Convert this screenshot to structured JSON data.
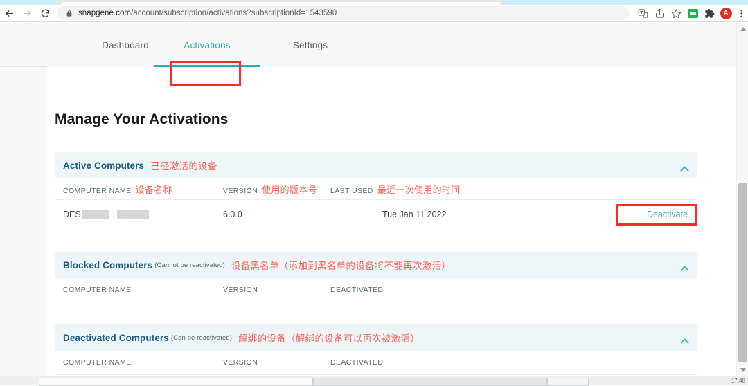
{
  "browser": {
    "url_prefix": "snapgene.com",
    "url_suffix": "/account/subscription/activations?subscriptionId=1543590",
    "back_icon": "back-arrow-icon",
    "forward_icon": "forward-arrow-icon",
    "reload_icon": "reload-icon",
    "lock_icon": "lock-icon",
    "translate_icon": "translate-icon",
    "share_icon": "share-icon",
    "bookmark_icon": "star-icon",
    "extension_green_icon": "green-extension-icon",
    "extensions_icon": "puzzle-piece-icon",
    "avatar_label": "A",
    "menu_icon": "three-dot-menu-icon"
  },
  "nav": {
    "tabs": [
      {
        "label": "Dashboard",
        "active": false
      },
      {
        "label": "Activations",
        "active": true
      },
      {
        "label": "Settings",
        "active": false
      }
    ]
  },
  "page": {
    "title": "Manage Your Activations"
  },
  "sections": [
    {
      "title_en": "Active Computers",
      "title_sub": "",
      "title_cn": "已经激活的设备",
      "collapse_icon": "chevron-up-icon",
      "columns": [
        {
          "label": "COMPUTER NAME",
          "cn": "设备名称"
        },
        {
          "label": "VERSION",
          "cn": "使用的版本号"
        },
        {
          "label": "LAST USED",
          "cn": "最近一次使用的时间"
        }
      ],
      "rows": [
        {
          "computer_name": "DES",
          "version": "6.0.0",
          "last_used": "Tue Jan 11 2022",
          "action": "Deactivate"
        }
      ]
    },
    {
      "title_en": "Blocked Computers",
      "title_sub": "(Cannot be reactivated)",
      "title_cn": "设备黑名单（添加到黑名单的设备将不能再次激活）",
      "collapse_icon": "chevron-up-icon",
      "columns": [
        {
          "label": "COMPUTER NAME",
          "cn": ""
        },
        {
          "label": "VERSION",
          "cn": ""
        },
        {
          "label": "DEACTIVATED",
          "cn": ""
        }
      ],
      "rows": []
    },
    {
      "title_en": "Deactivated Computers",
      "title_sub": "(Can be reactivated)",
      "title_cn": "解绑的设备（解绑的设备可以再次被激活）",
      "collapse_icon": "chevron-up-icon",
      "columns": [
        {
          "label": "COMPUTER NAME",
          "cn": ""
        },
        {
          "label": "VERSION",
          "cn": ""
        },
        {
          "label": "DEACTIVATED",
          "cn": ""
        }
      ],
      "rows": []
    }
  ],
  "taskbar": {
    "clock": "17:48"
  },
  "colors": {
    "teal": "#2aa9ae",
    "annotation_red": "#fc2b2b",
    "annotation_text_red": "#fb6155",
    "section_header_bg": "#eef5f8",
    "section_title_blue": "#1c5a80"
  }
}
